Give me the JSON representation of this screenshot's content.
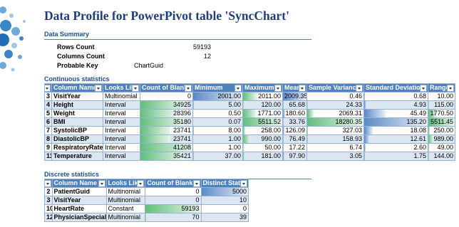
{
  "title": "Data Profile for PowerPivot table 'SyncChart'",
  "summary": {
    "heading": "Data Summary",
    "rows": [
      {
        "label": "Rows Count",
        "value": "59193"
      },
      {
        "label": "Columns Count",
        "value": "12"
      },
      {
        "label": "Probable Key",
        "value": "ChartGuid"
      }
    ]
  },
  "continuous": {
    "heading": "Continuous statistics",
    "headers": [
      "#",
      "Column Name",
      "Looks Like",
      "Count of Blanks",
      "Minimum",
      "Maximum",
      "Mean",
      "Sample Variance",
      "Standard Deviation",
      "Range"
    ],
    "rows": [
      {
        "n": "3",
        "name": "VisitYear",
        "looks": "Multinomial",
        "blanks": "0",
        "min": "2001.00",
        "max": "2011.00",
        "mean": "2009.35",
        "var": "0.46",
        "std": "0.68",
        "range": "10.00"
      },
      {
        "n": "4",
        "name": "Height",
        "looks": "Interval",
        "blanks": "34925",
        "min": "5.00",
        "max": "120.00",
        "mean": "65.68",
        "var": "24.33",
        "std": "4.93",
        "range": "115.00"
      },
      {
        "n": "5",
        "name": "Weight",
        "looks": "Interval",
        "blanks": "28396",
        "min": "0.50",
        "max": "1771.00",
        "mean": "180.60",
        "var": "2069.31",
        "std": "45.49",
        "range": "1770.50"
      },
      {
        "n": "6",
        "name": "BMI",
        "looks": "Interval",
        "blanks": "35180",
        "min": "0.07",
        "max": "5511.52",
        "mean": "33.76",
        "var": "18280.35",
        "std": "135.20",
        "range": "5511.45"
      },
      {
        "n": "7",
        "name": "SystolicBP",
        "looks": "Interval",
        "blanks": "23741",
        "min": "8.00",
        "max": "258.00",
        "mean": "126.09",
        "var": "327.03",
        "std": "18.08",
        "range": "250.00"
      },
      {
        "n": "8",
        "name": "DiastolicBP",
        "looks": "Interval",
        "blanks": "23741",
        "min": "1.00",
        "max": "990.00",
        "mean": "76.49",
        "var": "158.93",
        "std": "12.61",
        "range": "989.00"
      },
      {
        "n": "9",
        "name": "RespiratoryRate",
        "looks": "Interval",
        "blanks": "41208",
        "min": "1.00",
        "max": "50.00",
        "mean": "17.22",
        "var": "6.74",
        "std": "2.60",
        "range": "49.00"
      },
      {
        "n": "11",
        "name": "Temperature",
        "looks": "Interval",
        "blanks": "35421",
        "min": "37.00",
        "max": "181.00",
        "mean": "97.90",
        "var": "3.05",
        "std": "1.75",
        "range": "144.00"
      }
    ]
  },
  "discrete": {
    "heading": "Discrete statistics",
    "headers": [
      "#",
      "Column Name",
      "Looks Like",
      "Count of Blanks",
      "Distinct States"
    ],
    "rows": [
      {
        "n": "2",
        "name": "PatientGuid",
        "looks": "Multinomial",
        "blanks": "0",
        "distinct": "5000"
      },
      {
        "n": "3",
        "name": "VisitYear",
        "looks": "Multinomial",
        "blanks": "0",
        "distinct": "10"
      },
      {
        "n": "10",
        "name": "HeartRate",
        "looks": "Constant",
        "blanks": "59193",
        "distinct": "0"
      },
      {
        "n": "12",
        "name": "PhysicianSpecialty",
        "looks": "Multinomial",
        "blanks": "70",
        "distinct": "39"
      }
    ]
  },
  "colors": {
    "header": "#4f81bd",
    "band": "#dce6f1",
    "green_bar": "#63be7b",
    "blue_bar": "#5a8ac6",
    "title": "#1f3d7a"
  },
  "icons": {
    "filter": "dropdown-filter-icon"
  }
}
